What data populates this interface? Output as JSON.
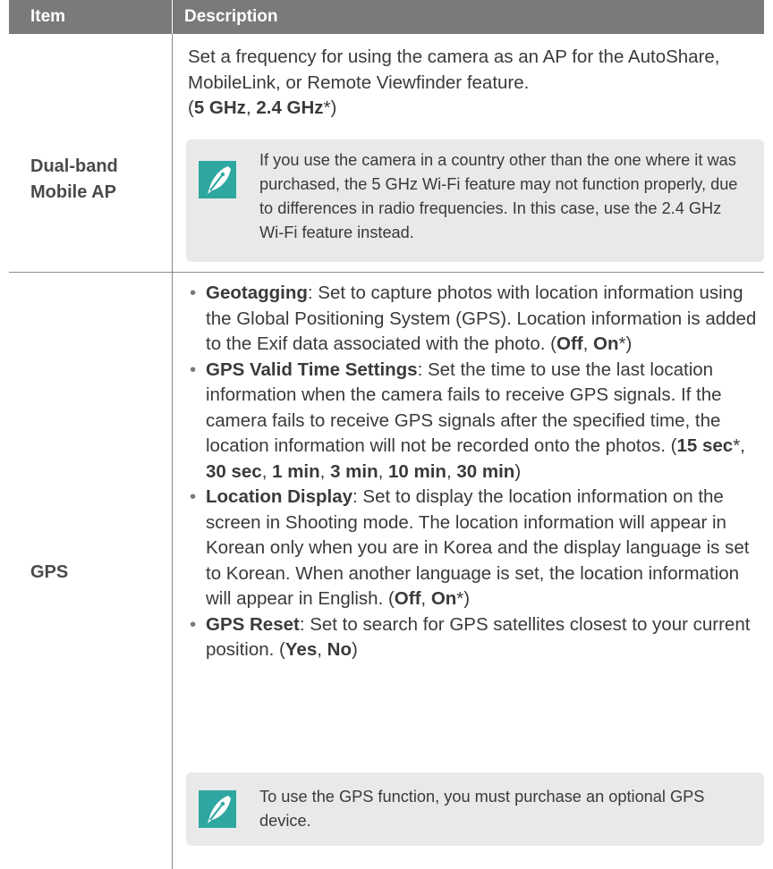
{
  "header": {
    "item": "Item",
    "description": "Description"
  },
  "rows": [
    {
      "item_line1": "Dual-band",
      "item_line2": "Mobile AP",
      "desc_text": "Set a frequency for using the camera as an AP for the AutoShare, MobileLink, or Remote Viewfinder feature.",
      "options": {
        "open": "(",
        "opt1": "5 GHz",
        "sep": ", ",
        "opt2": "2.4 GHz",
        "default_mark": "*",
        "close": ")"
      },
      "note": "If you use the camera in a country other than the one where it was purchased, the 5 GHz Wi-Fi feature may not function properly, due to differences in radio frequencies. In this case, use the 2.4 GHz Wi-Fi feature instead."
    },
    {
      "item": "GPS",
      "bullets": [
        {
          "term": "Geotagging",
          "text": ": Set to capture photos with location information using the Global Positioning System (GPS). Location information is added to the Exif data associated with the photo. (",
          "opt1": "Off",
          "sep1": ", ",
          "opt2": "On",
          "tail": "*)"
        },
        {
          "term": "GPS Valid Time Settings",
          "text": ": Set the time to use the last location information when the camera fails to receive GPS signals. If the camera fails to receive GPS signals after the specified time, the location information will not be recorded onto the photos. (",
          "o1": "15 sec",
          "star": "*",
          "o2": "30 sec",
          "o3": "1 min",
          "o4": "3 min",
          "o5": "10 min",
          "o6": "30 min",
          "sep": ", ",
          "close": ")"
        },
        {
          "term": "Location Display",
          "text": ": Set to display the location information on the screen in Shooting mode. The location information will appear in Korean only when you are in Korea and the display language is set to Korean. When another language is set, the location information will appear in English. (",
          "opt1": "Off",
          "sep1": ", ",
          "opt2": "On",
          "tail": "*)"
        },
        {
          "term": "GPS Reset",
          "text": ": Set to search for GPS satellites closest to your current position. (",
          "opt1": "Yes",
          "sep1": ", ",
          "opt2": "No",
          "tail": ")"
        }
      ],
      "note": "To use the GPS function, you must purchase an optional GPS device."
    }
  ],
  "icons": {
    "note": "pen-nib-icon"
  },
  "colors": {
    "header_bg": "#7a7a7a",
    "note_bg": "#e9e9e9",
    "icon_teal": "#2ea7a1"
  }
}
